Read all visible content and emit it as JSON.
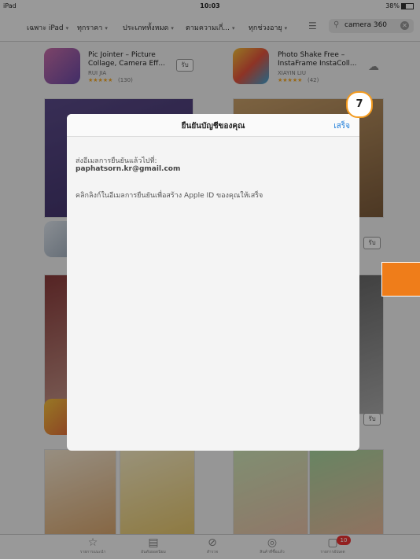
{
  "status": {
    "device": "iPad",
    "time": "10:03",
    "battery": "38%"
  },
  "nav": {
    "filters": [
      "เฉพาะ iPad",
      "ทุกราคา",
      "ประเภททั้งหมด",
      "ตามความเกี่...",
      "ทุกช่วงอายุ"
    ],
    "search_value": "camera 360"
  },
  "apps": [
    {
      "name1": "Pic Jointer – Picture",
      "name2": "Collage, Camera Eff...",
      "dev": "RUI JIA",
      "stars": "★★★★★",
      "ratings": "(130)",
      "action": "รับ"
    },
    {
      "name1": "Photo Shake Free –",
      "name2": "InstaFrame InstaColl...",
      "dev": "XIAYIN LIU",
      "stars": "★★★★★",
      "ratings": "(42)"
    }
  ],
  "side_buttons": {
    "get1": "รับ",
    "get2": "รับ"
  },
  "modal": {
    "title": "ยืนยันบัญชีของคุณ",
    "done": "เสร็จ",
    "line1": "ส่งอีเมลการยืนยันแล้วไปที่:",
    "email": "paphatsorn.kr@gmail.com",
    "line2": "คลิกลิงก์ในอีเมลการยืนยันเพื่อสร้าง Apple ID ของคุณให้เสร็จ"
  },
  "callout": "7",
  "tabs": [
    "รายการแนะนำ",
    "อันดับยอดนิยม",
    "สำรวจ",
    "สินค้าที่ซื้อแล้ว",
    "รายการอัปเดต"
  ],
  "update_badge": "10",
  "colors": {
    "accent": "#1b7bd9",
    "callout_border": "#f39a1e",
    "orange_box": "#ef7d1a",
    "badge": "#e33333"
  }
}
